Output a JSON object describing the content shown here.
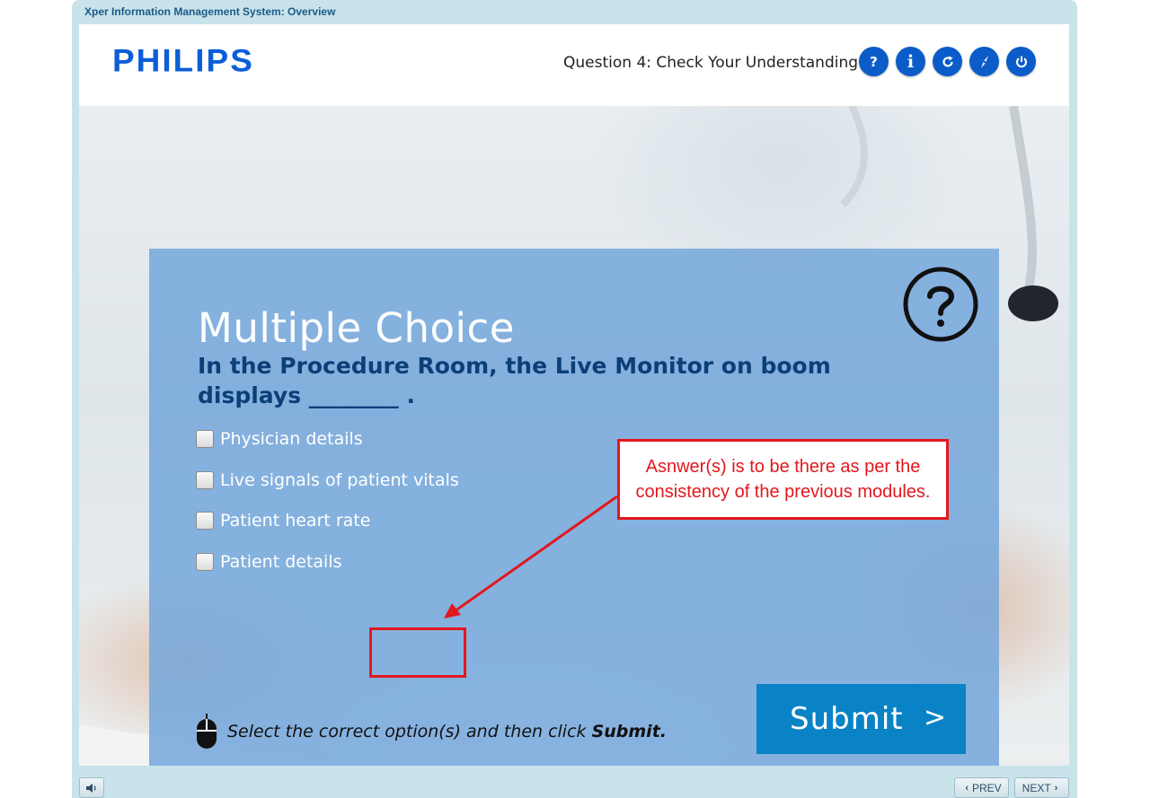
{
  "window": {
    "title": "Xper Information Management System: Overview"
  },
  "header": {
    "logo": "PHILIPS",
    "question_title": "Question 4: Check Your Understanding",
    "buttons": [
      {
        "name": "help",
        "glyph": "?"
      },
      {
        "name": "info",
        "glyph": "i"
      },
      {
        "name": "replay",
        "glyph": "↻"
      },
      {
        "name": "resources",
        "glyph": "compass"
      },
      {
        "name": "exit",
        "glyph": "power"
      }
    ]
  },
  "quiz": {
    "heading": "Multiple Choice",
    "question": "In the Procedure Room, the Live Monitor on boom displays ________ .",
    "options": [
      {
        "label": "Physician details",
        "checked": false
      },
      {
        "label": "Live signals of patient vitals",
        "checked": false
      },
      {
        "label": "Patient heart rate",
        "checked": false
      },
      {
        "label": "Patient details",
        "checked": false
      }
    ],
    "instruction_prefix": "Select the correct option(s) and then click ",
    "instruction_action": "Submit.",
    "submit_label": "Submit",
    "submit_arrow": ">"
  },
  "annotation": {
    "text": "Asnwer(s) is to be there as per the consistency of the previous modules.",
    "color": "#e3171e"
  },
  "footer": {
    "prev_label": "PREV",
    "next_label": "NEXT"
  },
  "colors": {
    "brand_blue": "#0b5ed7",
    "panel": "#78a8dc",
    "submit": "#0a83c6",
    "question_text": "#0c3f78"
  }
}
